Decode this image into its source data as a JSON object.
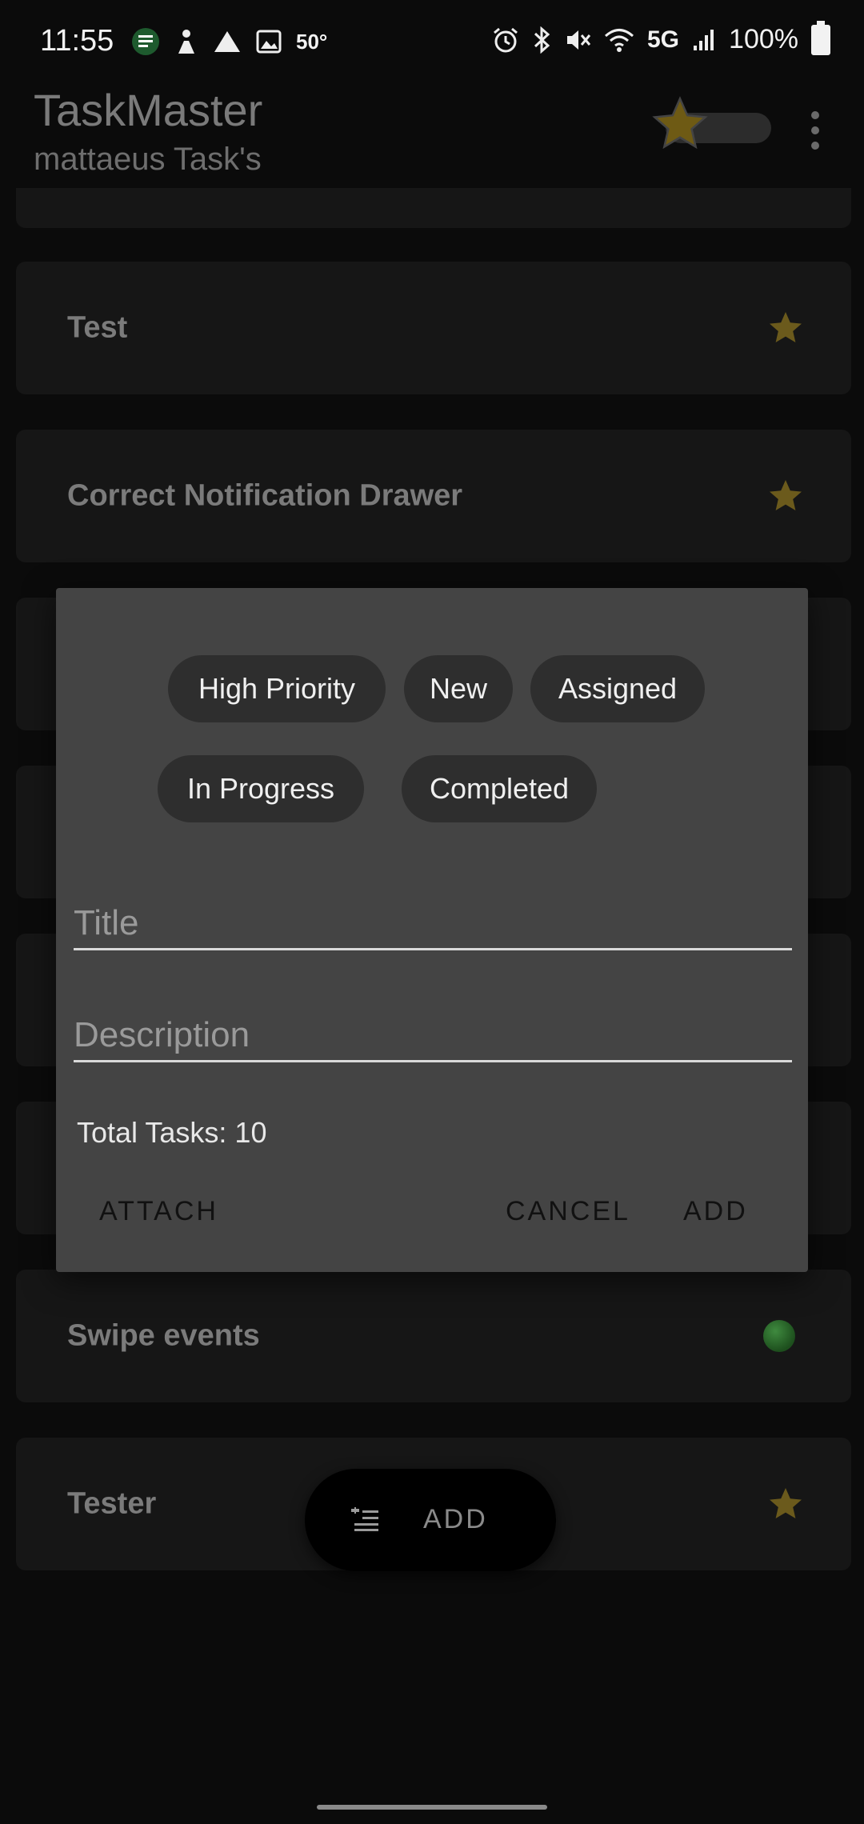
{
  "status_bar": {
    "time": "11:55",
    "temperature": "50°",
    "network": "5G",
    "battery": "100%",
    "icons": [
      "notes-icon",
      "fitness-icon",
      "triangle-icon",
      "image-icon",
      "alarm-icon",
      "bluetooth-icon",
      "mute-icon",
      "wifi-icon",
      "signal-icon",
      "battery-icon"
    ]
  },
  "app_bar": {
    "title": "TaskMaster",
    "subtitle": "mattaeus Task's"
  },
  "tasks": [
    {
      "title": "Test",
      "indicator": "star"
    },
    {
      "title": "Correct Notification Drawer",
      "indicator": "star"
    },
    {
      "title": "Swipe events",
      "indicator": "green-dot"
    },
    {
      "title": "Tester",
      "indicator": "star"
    }
  ],
  "fab": {
    "label": "ADD"
  },
  "dialog": {
    "chips": [
      "High Priority",
      "New",
      "Assigned",
      "In Progress",
      "Completed"
    ],
    "title_placeholder": "Title",
    "description_placeholder": "Description",
    "total_tasks": "Total Tasks: 10",
    "attach_label": "ATTACH",
    "cancel_label": "CANCEL",
    "add_label": "ADD"
  },
  "colors": {
    "background": "#0b0b0b",
    "card": "#161616",
    "dialog": "#444444",
    "chip": "#2e2e2e",
    "star": "#6b5a1c"
  }
}
